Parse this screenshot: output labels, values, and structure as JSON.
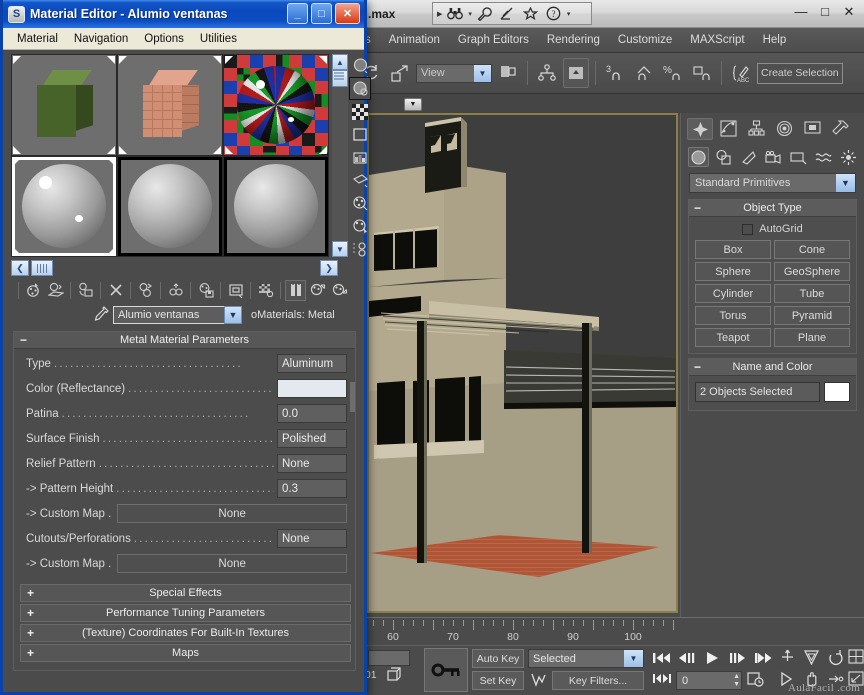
{
  "max_window": {
    "title_suffix": ".max",
    "window_buttons": {
      "minimize": "—",
      "maximize": "□",
      "close": "✕"
    },
    "quick_access": [
      "binoculars-icon",
      "wrench-icon",
      "satellite-icon",
      "star-icon",
      "help-icon"
    ],
    "menu": [
      "s",
      "Animation",
      "Graph Editors",
      "Rendering",
      "Customize",
      "MAXScript",
      "Help"
    ],
    "toolbar": {
      "view_combo": "View",
      "selection_set_placeholder": "Create Selection S",
      "number_badge": "3",
      "percent_badge": "%"
    },
    "viewport": {
      "label_menu": "▼"
    },
    "timeline": {
      "labels": [
        "60",
        "70",
        "80",
        "90",
        "100"
      ]
    },
    "statusbar": {
      "frame_value": ":01",
      "auto_key": "Auto Key",
      "set_key": "Set Key",
      "key_mode_combo": "Selected",
      "key_filters": "Key Filters...",
      "current_frame": "0",
      "watermark": "AulaFacil .com"
    },
    "command_panel": {
      "tabs": [
        "create-tab",
        "modify-tab",
        "hierarchy-tab",
        "motion-tab",
        "display-tab",
        "utilities-tab"
      ],
      "categories": [
        "geometry-icon",
        "shapes-icon",
        "lights-icon",
        "cameras-icon",
        "helpers-icon",
        "spacewarps-icon",
        "systems-icon"
      ],
      "category_combo": "Standard Primitives",
      "object_type": {
        "header": "Object Type",
        "autogrid_label": "AutoGrid",
        "buttons": [
          "Box",
          "Cone",
          "Sphere",
          "GeoSphere",
          "Cylinder",
          "Tube",
          "Torus",
          "Pyramid",
          "Teapot",
          "Plane"
        ]
      },
      "name_and_color": {
        "header": "Name and Color",
        "name_value": "2 Objects Selected",
        "color": "#ffffff"
      }
    }
  },
  "material_editor": {
    "title": "Material Editor - Alumio ventanas",
    "logo": "S",
    "window_buttons": {
      "minimize": "_",
      "maximize": "□",
      "close": "✕"
    },
    "menu": [
      "Material",
      "Navigation",
      "Options",
      "Utilities"
    ],
    "slots": [
      {
        "name": "slot-1-grass-cube",
        "kind": "cube",
        "color": "#4e6b2e",
        "selected": false
      },
      {
        "name": "slot-2-brick-cube",
        "kind": "cube",
        "color": "#c87a5e",
        "selected": false
      },
      {
        "name": "slot-3-checker-sphere",
        "kind": "checker",
        "color": "#2a3f9e",
        "selected": false
      },
      {
        "name": "slot-4-gray-sphere",
        "kind": "sphere",
        "color": "#a8a8a8",
        "selected": true
      },
      {
        "name": "slot-5-gray-sphere",
        "kind": "sphere",
        "color": "#a8a8a8",
        "selected": true
      },
      {
        "name": "slot-6-gray-sphere",
        "kind": "sphere",
        "color": "#a8a8a8",
        "selected": true
      }
    ],
    "side_tools": [
      "sample-type-icon",
      "backlight-icon",
      "background-checker-icon",
      "sample-uv-tiling-icon",
      "video-color-check-icon",
      "make-preview-icon",
      "options-icon",
      "select-by-material-icon",
      "material-id-channel-icon"
    ],
    "toolbar": [
      "get-material-icon",
      "put-to-scene-icon",
      "assign-to-selection-icon",
      "reset-map-icon",
      "make-material-copy-icon",
      "make-unique-icon",
      "put-to-library-icon",
      "material-effects-channel-icon",
      "show-map-in-viewport-icon",
      "show-end-result-icon",
      "go-to-parent-icon",
      "go-forward-to-sibling-icon"
    ],
    "pipette_icon": "eyedropper-icon",
    "material_name": "Alumio ventanas",
    "material_type": "oMaterials: Metal",
    "parameters": {
      "header": "Metal Material Parameters",
      "rows": [
        {
          "label": "Type",
          "value": "Aluminum",
          "style": "field"
        },
        {
          "label": "Color (Reflectance)",
          "value": "",
          "style": "swatch"
        },
        {
          "label": "Patina",
          "value": "0.0",
          "style": "field"
        },
        {
          "label": "Surface Finish",
          "value": "Polished",
          "style": "field"
        },
        {
          "label": "Relief Pattern",
          "value": "None",
          "style": "field"
        },
        {
          "label": "-> Pattern Height",
          "value": "0.3",
          "style": "field"
        },
        {
          "label": "-> Custom Map .",
          "value": "None",
          "style": "wide"
        },
        {
          "label": "Cutouts/Perforations",
          "value": "None",
          "style": "field"
        },
        {
          "label": "-> Custom Map .",
          "value": "None",
          "style": "wide"
        }
      ]
    },
    "collapsed_rollouts": [
      "Special Effects",
      "Performance Tuning Parameters",
      "(Texture) Coordinates For Built-In Textures",
      "Maps"
    ],
    "hscroll": {
      "left_arrow": "❮",
      "right_arrow": "❯"
    }
  }
}
